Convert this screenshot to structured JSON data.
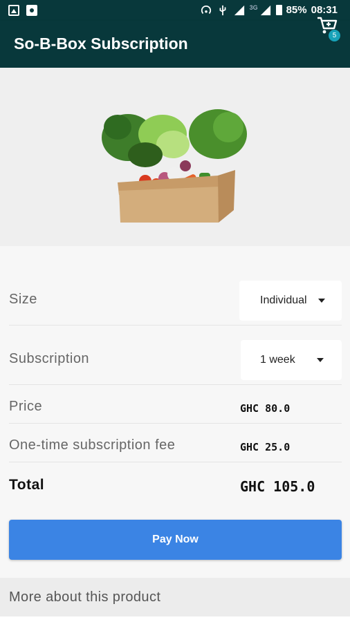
{
  "status_bar": {
    "battery_percent": "85%",
    "time": "08:31",
    "network_type": "3G",
    "icons": [
      "image-icon",
      "settings-icon",
      "hotspot-icon",
      "usb-icon",
      "signal-icon",
      "signal-icon",
      "battery-icon"
    ]
  },
  "app_bar": {
    "title": "So-B-Box Subscription",
    "cart_count": "5",
    "cart_icon": "cart-icon",
    "color": "#08383b"
  },
  "product": {
    "image": "vegetable-box"
  },
  "options": {
    "size_label": "Size",
    "size_value": "Individual",
    "subscription_label": "Subscription",
    "subscription_value": "1 week",
    "price_label": "Price",
    "price_value": "GHC 80.0",
    "fee_label": "One-time subscription fee",
    "fee_value": "GHC 25.0",
    "total_label": "Total",
    "total_value": "GHC 105.0"
  },
  "pay_button": {
    "label": "Pay Now",
    "color": "#3b84e4"
  },
  "more": {
    "label": "More about this product"
  }
}
